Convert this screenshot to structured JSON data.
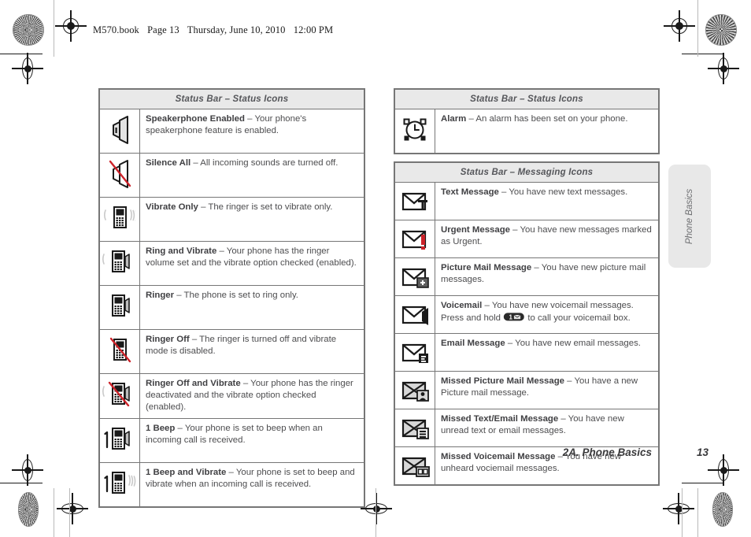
{
  "running_header": {
    "file": "M570.book",
    "page_label": "Page 13",
    "day": "Thursday, June 10, 2010",
    "time": "12:00 PM"
  },
  "side_tab": {
    "label": "Phone Basics"
  },
  "footer": {
    "section": "2A. Phone Basics",
    "page_number": "13"
  },
  "tables": [
    {
      "id": "status-icons-left",
      "header": "Status Bar – Status Icons",
      "rows": [
        {
          "icon": "speaker-on-icon",
          "term": "Speakerphone Enabled",
          "sep": " – ",
          "desc": "Your phone's speakerphone feature is enabled."
        },
        {
          "icon": "speaker-muted-icon",
          "term": "Silence All",
          "sep": " – ",
          "desc": "All incoming sounds are turned off."
        },
        {
          "icon": "phone-vibrate-icon",
          "term": "Vibrate Only",
          "sep": " – ",
          "desc": "The ringer is set to vibrate only."
        },
        {
          "icon": "phone-ring-vibrate-icon",
          "term": "Ring and Vibrate",
          "sep": " – ",
          "desc": "Your phone has the ringer volume set and the vibrate option checked (enabled)."
        },
        {
          "icon": "phone-ring-icon",
          "term": "Ringer",
          "sep": " – ",
          "desc": "The phone is set to ring only."
        },
        {
          "icon": "phone-ringer-off-icon",
          "term": "Ringer Off",
          "sep": " – ",
          "desc": "The ringer is turned off and vibrate mode is disabled."
        },
        {
          "icon": "phone-ringer-off-vibrate-icon",
          "term": "Ringer Off and Vibrate",
          "sep": " – ",
          "desc": "Your phone has the ringer deactivated and the vibrate option checked (enabled)."
        },
        {
          "icon": "phone-one-beep-icon",
          "term": "1 Beep",
          "sep": " – ",
          "desc": "Your phone is set to beep when an incoming call is received."
        },
        {
          "icon": "phone-one-beep-vibrate-icon",
          "term": "1 Beep and Vibrate",
          "sep": " – ",
          "desc": "Your phone is set to beep and vibrate when an incoming call is received."
        }
      ]
    },
    {
      "id": "status-icons-right",
      "header": "Status Bar – Status Icons",
      "rows": [
        {
          "icon": "alarm-clock-icon",
          "term": "Alarm",
          "sep": " – ",
          "desc": "An alarm has been set on your phone."
        }
      ]
    },
    {
      "id": "messaging-icons",
      "header": "Status Bar – Messaging Icons",
      "rows": [
        {
          "icon": "envelope-text-icon",
          "term": "Text Message",
          "sep": " – ",
          "desc": "You have new text messages."
        },
        {
          "icon": "envelope-urgent-icon",
          "term": "Urgent Message",
          "sep": " – ",
          "desc": "You have new messages marked as Urgent."
        },
        {
          "icon": "envelope-picture-icon",
          "term": "Picture Mail Message",
          "sep": " – ",
          "desc": "You have new picture mail messages."
        },
        {
          "icon": "envelope-voicemail-icon",
          "term": "Voicemail",
          "sep": " – ",
          "desc": "You have new voicemail messages.",
          "desc2_before": "Press and hold ",
          "inline_key": "1-key-voicemail",
          "desc2_after": " to call your voicemail box."
        },
        {
          "icon": "envelope-email-icon",
          "term": "Email Message",
          "sep": " – ",
          "desc": "You have new email messages."
        },
        {
          "icon": "envelope-missed-picture-icon",
          "term": "Missed Picture Mail Message",
          "sep": " – ",
          "desc": "You have a new Picture mail message."
        },
        {
          "icon": "envelope-missed-text-email-icon",
          "term": "Missed Text/Email Message",
          "sep": " – ",
          "desc": "You have new unread text or email messages."
        },
        {
          "icon": "envelope-missed-voicemail-icon",
          "term": "Missed Voicemail Message",
          "sep": " – ",
          "desc": "You have new unheard vociemail messages."
        }
      ]
    }
  ],
  "colors": {
    "header_fill": "#e9e9e9",
    "border": "#767676",
    "body_text": "#4d4d4f",
    "term_text": "#404043",
    "accent_red": "#cc2229",
    "icon_dark": "#1a1a1a",
    "icon_grey": "#8c8c8c"
  }
}
